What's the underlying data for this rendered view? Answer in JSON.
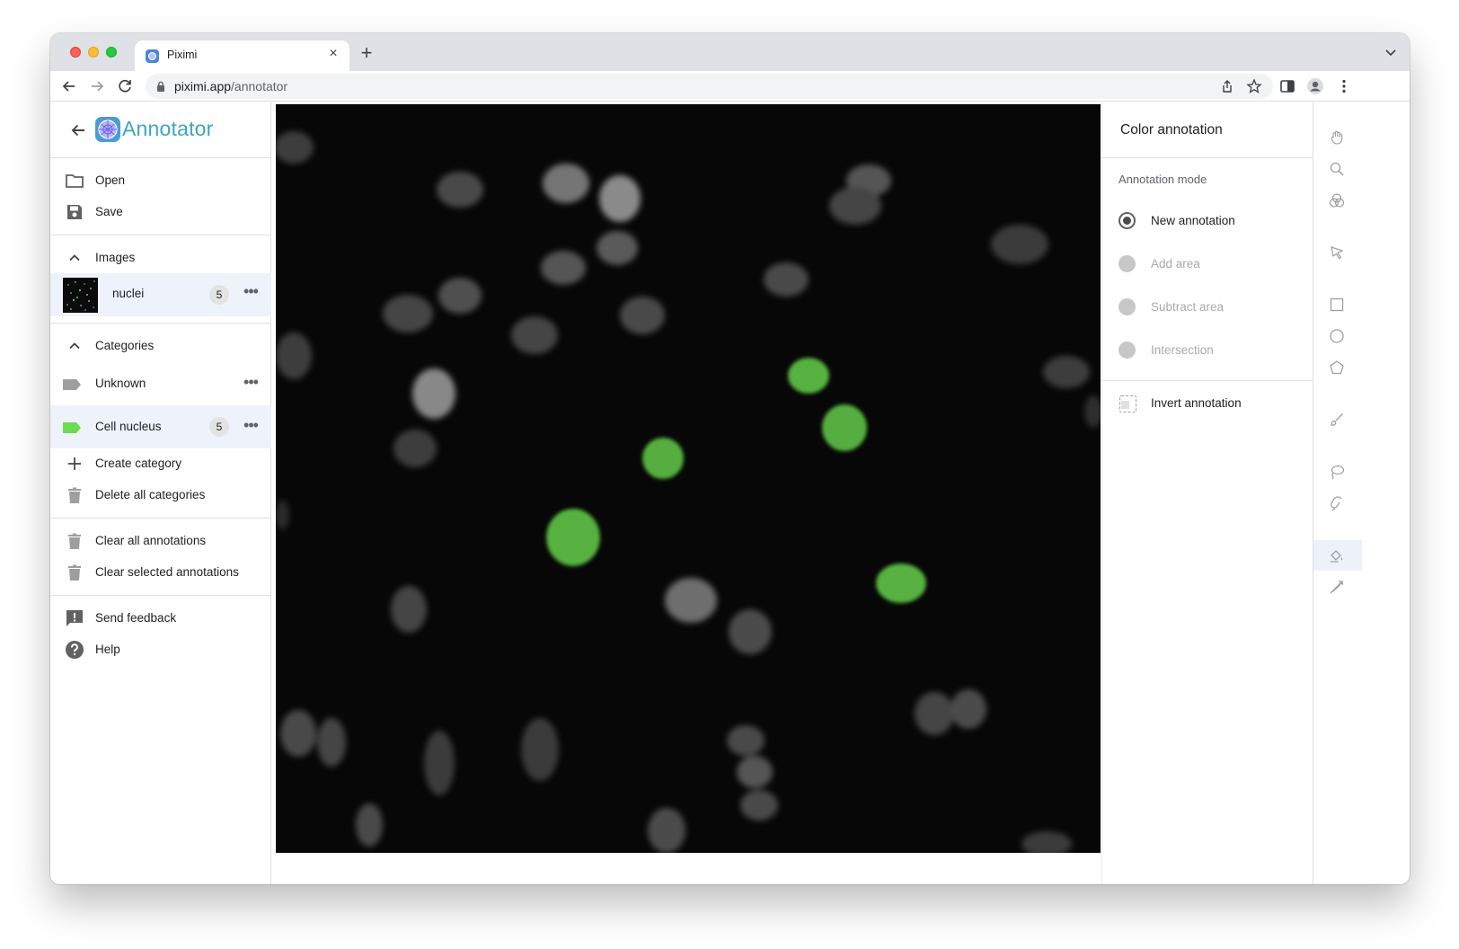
{
  "browser": {
    "tab_title": "Piximi",
    "tab_close": "×",
    "new_tab": "+",
    "url_host": "piximi.app",
    "url_path": "/annotator"
  },
  "app": {
    "title": "Annotator"
  },
  "file_menu": {
    "open": "Open",
    "save": "Save"
  },
  "images": {
    "header": "Images",
    "items": [
      {
        "name": "nuclei",
        "count": "5"
      }
    ]
  },
  "categories": {
    "header": "Categories",
    "items": [
      {
        "name": "Unknown",
        "color": "#9e9e9e",
        "count": ""
      },
      {
        "name": "Cell nucleus",
        "color": "#6bdc4f",
        "count": "5"
      }
    ],
    "create": "Create category",
    "delete_all": "Delete all categories"
  },
  "annotations_menu": {
    "clear_all": "Clear all annotations",
    "clear_selected": "Clear selected annotations"
  },
  "help_menu": {
    "feedback": "Send feedback",
    "help": "Help"
  },
  "right_panel": {
    "title": "Color annotation",
    "mode_label": "Annotation mode",
    "modes": [
      {
        "label": "New annotation",
        "selected": true,
        "enabled": true
      },
      {
        "label": "Add area",
        "selected": false,
        "enabled": false
      },
      {
        "label": "Subtract area",
        "selected": false,
        "enabled": false
      },
      {
        "label": "Intersection",
        "selected": false,
        "enabled": false
      }
    ],
    "invert": "Invert annotation"
  },
  "colors": {
    "accent": "#3ea5c0",
    "annotation_fill": "#6bdc4f",
    "selected_row": "#eef2fb"
  },
  "tools": [
    "hand-icon",
    "zoom-icon",
    "color-adjust-icon",
    "pointer-icon",
    "rectangle-icon",
    "ellipse-icon",
    "polygon-icon",
    "brush-icon",
    "lasso-icon",
    "magnetic-icon",
    "color-annotation-icon",
    "quick-annotation-icon"
  ]
}
